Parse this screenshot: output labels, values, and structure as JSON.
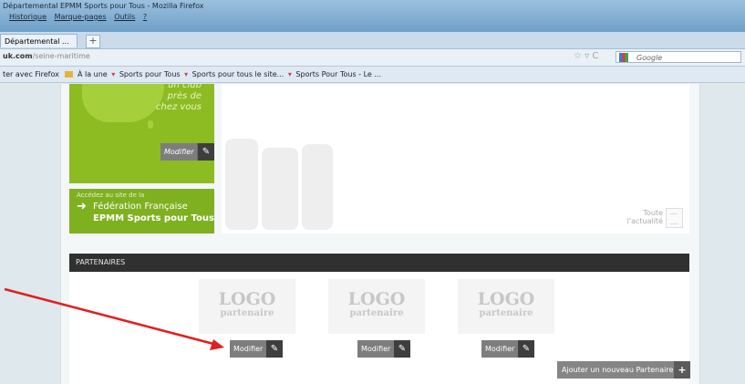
{
  "browser": {
    "window_title": "Départemental EPMM Sports pour Tous - Mozilla Firefox",
    "menu": [
      "Historique",
      "Marque-pages",
      "Outils",
      "?"
    ],
    "tab_label": "Départemental ...",
    "new_tab": "+",
    "url_host": "uk.com",
    "url_path": "/seine-maritime",
    "search_placeholder": "Google",
    "bookmarks": {
      "start": "ter avec Firefox",
      "items": [
        "À la une",
        "Sports pour Tous",
        "Sports pour tous le site...",
        "Sports Pour Tous - Le ..."
      ]
    }
  },
  "map": {
    "lines": [
      "un club",
      "près de",
      "chez vous"
    ],
    "modify_label": "Modifier"
  },
  "federation": {
    "small": "Accédez au site de la",
    "line1": "Fédération Française",
    "line2": "EPMM Sports pour Tous"
  },
  "news": {
    "link_line1": "Toute",
    "link_line2": "l'actualité"
  },
  "partners": {
    "heading": "PARTENAIRES",
    "logos": [
      {
        "big": "LOGO",
        "small": "partenaire",
        "modify": "Modifier"
      },
      {
        "big": "LOGO",
        "small": "partenaire",
        "modify": "Modifier"
      },
      {
        "big": "LOGO",
        "small": "partenaire",
        "modify": "Modifier"
      }
    ],
    "add_label": "Ajouter un nouveau Partenaire",
    "add_plus": "+"
  },
  "colors": {
    "green_dark": "#8dbb22",
    "green": "#7fb020",
    "annotation": "#e02020"
  }
}
